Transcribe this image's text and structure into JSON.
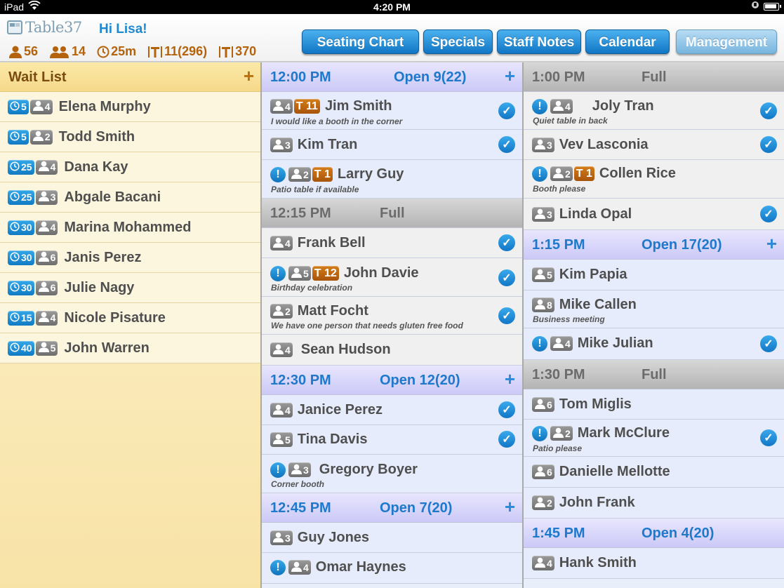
{
  "status_bar": {
    "device": "iPad",
    "time": "4:20 PM"
  },
  "header": {
    "logo_text": "Table37",
    "greeting": "Hi Lisa!",
    "stats": {
      "guests": "56",
      "parties": "14",
      "wait_time": "25m",
      "tables": "11(296)",
      "covers": "370"
    }
  },
  "nav": {
    "seating_chart": "Seating Chart",
    "specials": "Specials",
    "staff_notes": "Staff Notes",
    "calendar": "Calendar",
    "management": "Management"
  },
  "waitlist": {
    "title": "Wait List",
    "items": [
      {
        "wait": "5",
        "party": "4",
        "name": "Elena Murphy"
      },
      {
        "wait": "5",
        "party": "2",
        "name": "Todd Smith"
      },
      {
        "wait": "25",
        "party": "4",
        "name": "Dana Kay"
      },
      {
        "wait": "25",
        "party": "3",
        "name": "Abgale Bacani"
      },
      {
        "wait": "30",
        "party": "4",
        "name": "Marina Mohammed"
      },
      {
        "wait": "30",
        "party": "6",
        "name": "Janis Perez"
      },
      {
        "wait": "30",
        "party": "6",
        "name": "Julie Nagy"
      },
      {
        "wait": "15",
        "party": "4",
        "name": "Nicole Pisature"
      },
      {
        "wait": "40",
        "party": "5",
        "name": "John Warren"
      }
    ]
  },
  "slots": {
    "s1200": {
      "time": "12:00 PM",
      "status": "Open 9(22)"
    },
    "s1215": {
      "time": "12:15 PM",
      "status": "Full"
    },
    "s1230": {
      "time": "12:30 PM",
      "status": "Open 12(20)"
    },
    "s1245": {
      "time": "12:45 PM",
      "status": "Open 7(20)"
    },
    "s0100": {
      "time": "1:00 PM",
      "status": "Full"
    },
    "s0115": {
      "time": "1:15 PM",
      "status": "Open 17(20)"
    },
    "s0130": {
      "time": "1:30 PM",
      "status": "Full"
    },
    "s0145": {
      "time": "1:45 PM",
      "status": "Open 4(20)"
    }
  },
  "reservations": {
    "r1": {
      "party": "4",
      "table": "T 11",
      "name": "Jim Smith",
      "note": "I would like a booth in the corner"
    },
    "r2": {
      "party": "3",
      "name": "Kim Tran"
    },
    "r3": {
      "alert": "!",
      "party": "2",
      "table": "T 1",
      "name": "Larry Guy",
      "note": "Patio table if available"
    },
    "r4": {
      "party": "4",
      "name": "Frank Bell"
    },
    "r5": {
      "alert": "!",
      "party": "5",
      "table": "T 12",
      "name": "John Davie",
      "note": "Birthday celebration"
    },
    "r6": {
      "party": "2",
      "name": "Matt Focht",
      "note": "We have one person that needs gluten free food"
    },
    "r7": {
      "party": "4",
      "name": "Sean Hudson"
    },
    "r8": {
      "party": "4",
      "name": "Janice Perez"
    },
    "r9": {
      "party": "5",
      "name": "Tina Davis"
    },
    "r10": {
      "alert": "!",
      "party": "3",
      "name": "Gregory Boyer",
      "note": "Corner booth"
    },
    "r11": {
      "party": "3",
      "name": "Guy Jones"
    },
    "r12": {
      "alert": "!",
      "party": "4",
      "name": "Omar Haynes"
    },
    "c1": {
      "alert": "!",
      "party": "4",
      "name": "Joly Tran",
      "note": "Quiet table in back"
    },
    "c2": {
      "party": "3",
      "name": "Vev Lasconia"
    },
    "c3": {
      "alert": "!",
      "party": "2",
      "table": "T 1",
      "name": "Collen Rice",
      "note": "Booth please"
    },
    "c4": {
      "party": "3",
      "name": "Linda Opal"
    },
    "c5": {
      "party": "5",
      "name": "Kim Papia"
    },
    "c6": {
      "party": "8",
      "name": "Mike Callen",
      "note": "Business meeting"
    },
    "c7": {
      "alert": "!",
      "party": "4",
      "name": "Mike Julian"
    },
    "c8": {
      "party": "6",
      "name": "Tom Miglis"
    },
    "c9": {
      "alert": "!",
      "party": "2",
      "name": "Mark McClure",
      "note": "Patio please"
    },
    "c10": {
      "party": "6",
      "name": "Danielle Mellotte"
    },
    "c11": {
      "party": "2",
      "name": "John Frank"
    },
    "c12": {
      "party": "4",
      "name": "Hank Smith"
    }
  },
  "glyphs": {
    "plus": "+",
    "check": "✓"
  },
  "colors": {
    "accent": "#1e89d2",
    "stats": "#b5620c",
    "waitlist_bg": "#fdf3cf",
    "open_header": "#ccc9f8",
    "full_header": "#b4b4b4",
    "table_badge": "#c0680f"
  }
}
